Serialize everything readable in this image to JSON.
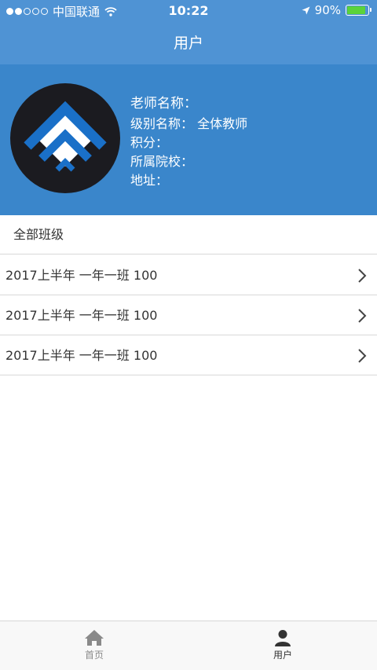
{
  "status_bar": {
    "carrier": "中国联通",
    "time": "10:22",
    "battery": "90%",
    "battery_level": 0.9
  },
  "nav": {
    "title": "用户"
  },
  "profile": {
    "teacher_name": "老师名称：",
    "level": "级别名称：  全体教师",
    "points": "积分：",
    "school": "所属院校：",
    "address": "地址："
  },
  "classes": {
    "section_title": "全部班级",
    "items": [
      {
        "label": "2017上半年  一年一班  100"
      },
      {
        "label": "2017上半年  一年一班  100"
      },
      {
        "label": "2017上半年  一年一班  100"
      }
    ]
  },
  "tabbar": {
    "tabs": [
      {
        "label": "首页",
        "icon": "home-icon"
      },
      {
        "label": "用户",
        "icon": "user-icon"
      }
    ]
  },
  "colors": {
    "nav": "#4f93d4",
    "profile_bg": "#3a86cb",
    "logo_blue": "#1a70c8"
  }
}
